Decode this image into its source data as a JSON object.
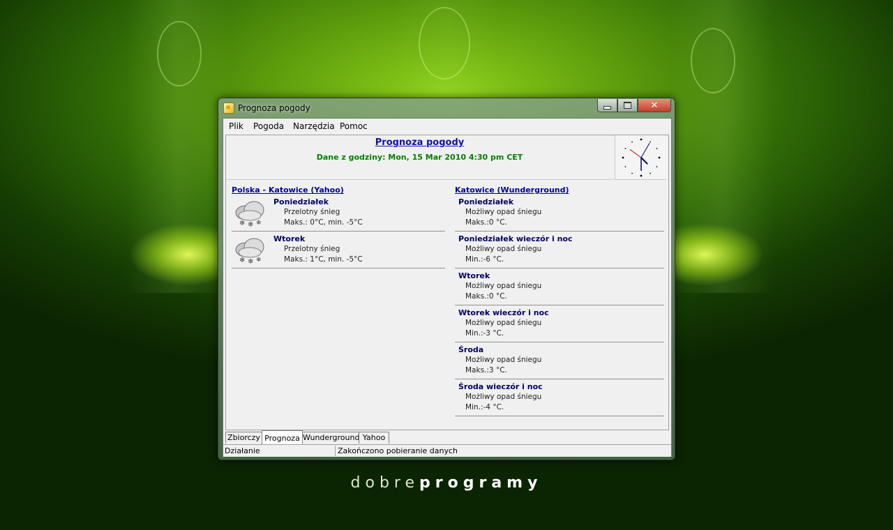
{
  "window": {
    "title": "Prognoza pogody"
  },
  "menu": {
    "items": [
      "Plik",
      "Pogoda",
      "Narzędzia",
      "Pomoc"
    ]
  },
  "header": {
    "title": "Prognoza pogody",
    "subtitle": "Dane z godziny: Mon, 15 Mar 2010 4:30 pm CET"
  },
  "yahoo": {
    "title": "Polska - Katowice (Yahoo)",
    "items": [
      {
        "day": "Poniedziałek",
        "cond": "Przelotny śnieg",
        "temp": "Maks.: 0°C, min. -5°C",
        "icon": "snow-cloud-icon"
      },
      {
        "day": "Wtorek",
        "cond": "Przelotny śnieg",
        "temp": "Maks.: 1°C, min. -5°C",
        "icon": "snow-cloud-icon"
      }
    ]
  },
  "wunderground": {
    "title": "Katowice (Wunderground)",
    "items": [
      {
        "day": "Poniedziałek",
        "cond": "Możliwy opad śniegu",
        "temp": "Maks.:0 °C."
      },
      {
        "day": "Poniedziałek wieczór i noc",
        "cond": "Możliwy opad śniegu",
        "temp": "Min.:-6 °C."
      },
      {
        "day": "Wtorek",
        "cond": "Możliwy opad śniegu",
        "temp": "Maks.:0 °C."
      },
      {
        "day": "Wtorek wieczór i noc",
        "cond": "Możliwy opad śniegu",
        "temp": "Min.:-3 °C."
      },
      {
        "day": "Środa",
        "cond": "Możliwy opad śniegu",
        "temp": "Maks.:3 °C."
      },
      {
        "day": "Środa wieczór i noc",
        "cond": "Możliwy opad śniegu",
        "temp": "Min.:-4 °C."
      }
    ]
  },
  "tabs": {
    "items": [
      "Zbiorczy",
      "Prognoza",
      "Wunderground",
      "Yahoo"
    ],
    "active": "Prognoza"
  },
  "status": {
    "left": "Działanie",
    "right": "Zakończono pobieranie danych"
  },
  "clock": {
    "hour": 4,
    "minute": 30
  },
  "brand": {
    "part1": "dobre",
    "part2": "programy"
  }
}
